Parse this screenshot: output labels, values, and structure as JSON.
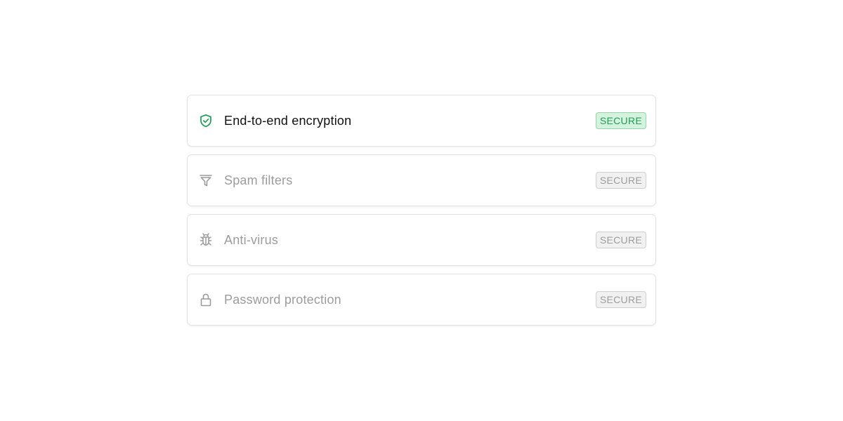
{
  "colors": {
    "accent": "#1f9e54",
    "accent_bg": "#d4f2de",
    "inactive_text": "#9c9c9c",
    "active_text": "#111111"
  },
  "items": [
    {
      "icon": "shield-check-icon",
      "label": "End-to-end encryption",
      "badge": "SECURE",
      "active": true
    },
    {
      "icon": "filter-icon",
      "label": "Spam filters",
      "badge": "SECURE",
      "active": false
    },
    {
      "icon": "bug-icon",
      "label": "Anti-virus",
      "badge": "SECURE",
      "active": false
    },
    {
      "icon": "lock-icon",
      "label": "Password protection",
      "badge": "SECURE",
      "active": false
    }
  ]
}
